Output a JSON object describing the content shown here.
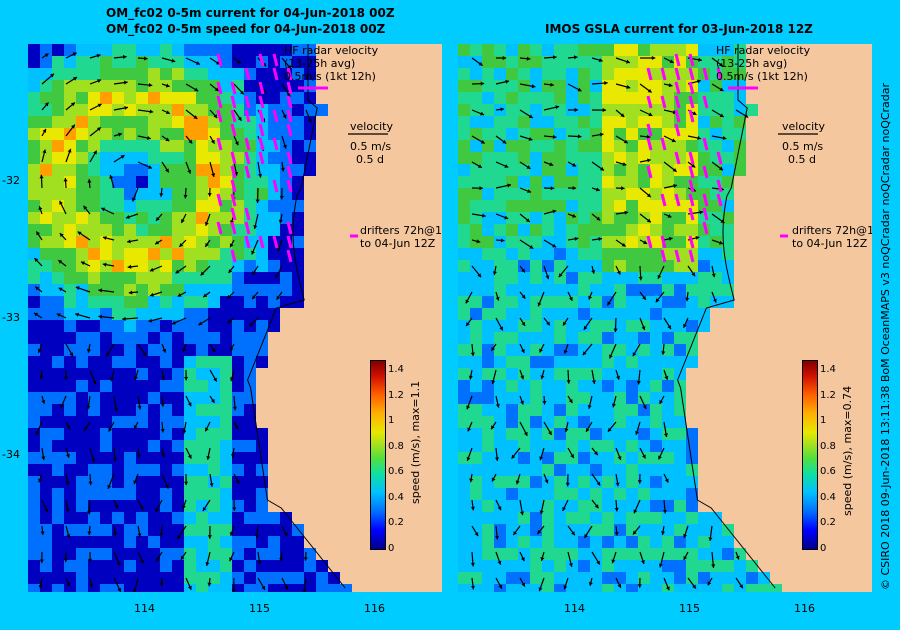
{
  "left_panel": {
    "title_line1": "OM_fc02 0-5m current for 04-Jun-2018 00Z",
    "title_line2": "OM_fc02 0-5m speed for 04-Jun-2018 00Z",
    "hf_line1": "HF radar velocity",
    "hf_line2": "(13-25h avg)",
    "hf_line3": "0.5m/s (1kt 12h)",
    "vel_line1": "velocity",
    "vel_line2": "0.5 m/s",
    "vel_line3": "0.5 d",
    "drift_line1": "drifters 72h@12h",
    "drift_line2": "to 04-Jun 12Z",
    "colorbar_title": "speed (m/s), max=1.1"
  },
  "right_panel": {
    "title": "IMOS GSLA current for 03-Jun-2018 12Z",
    "hf_line1": "HF radar velocity",
    "hf_line2": "(13-25h avg)",
    "hf_line3": "0.5m/s (1kt 12h)",
    "vel_line1": "velocity",
    "vel_line2": "0.5 m/s",
    "vel_line3": "0.5 d",
    "drift_line1": "drifters 72h@12h",
    "drift_line2": "to 04-Jun 12Z",
    "colorbar_title": "speed (m/s), max=0.74"
  },
  "axes": {
    "lat_labels": [
      "-32",
      "-33",
      "-34"
    ],
    "lon_labels": [
      "114",
      "115",
      "116"
    ]
  },
  "colorbar": {
    "ticks": [
      "1.4",
      "1.2",
      "1",
      "0.8",
      "0.6",
      "0.4",
      "0.2",
      "0"
    ]
  },
  "credit": "© CSIRO 2018   09-Jun-2018 13:11:38 BoM OceanMAPS v3 noQCradar noQCradar noQCradar",
  "colors": {
    "background": "#00ccff",
    "land": "#f5c79f",
    "hf_arrow": "#ff00ff"
  }
}
